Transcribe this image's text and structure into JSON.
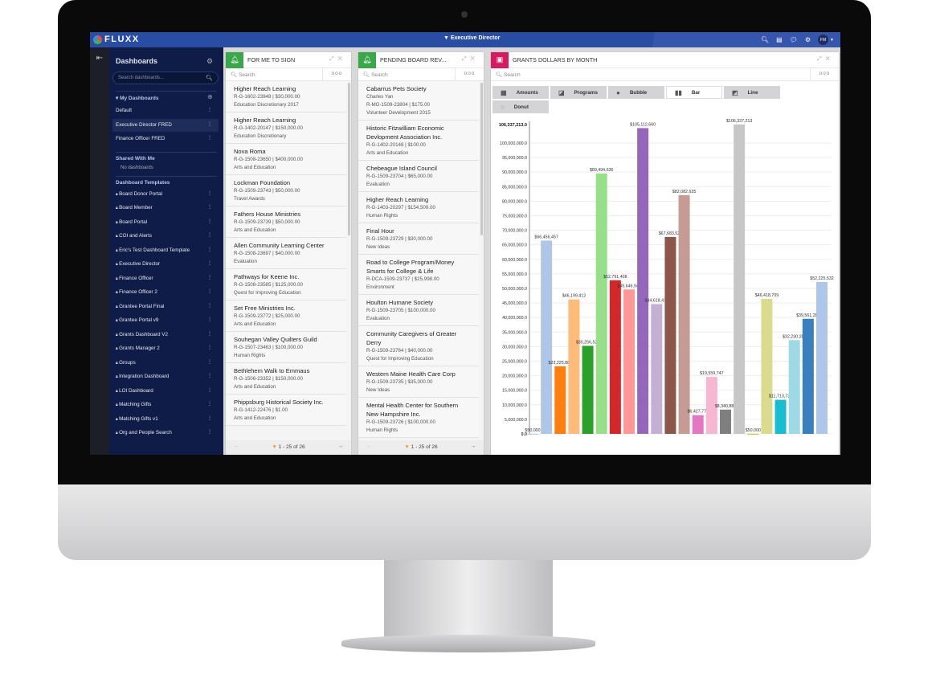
{
  "app": {
    "logo": "FLUXX",
    "title": "Executive Director",
    "user_initials": "FM"
  },
  "topbar_icons": [
    "search-icon",
    "card-icon",
    "chat-icon",
    "settings-icon"
  ],
  "sidebar": {
    "title": "Dashboards",
    "search_placeholder": "Search dashboards...",
    "my_dashboards": {
      "label": "My Dashboards",
      "items": [
        "Default",
        "Executive Director FRED",
        "Finance Officer FRED"
      ],
      "active": "Executive Director FRED"
    },
    "shared": {
      "label": "Shared With Me",
      "empty": "No dashboards"
    },
    "templates": {
      "label": "Dashboard Templates",
      "items": [
        "Board Donor Portal",
        "Board Member",
        "Board Portal",
        "COI and Alerts",
        "Eric's Test Dashboard Template",
        "Executive Director",
        "Finance Officer",
        "Finance Officer 2",
        "Grantee Portal Final",
        "Grantee Portal v9",
        "Grants Dashboard V2",
        "Grants Manager 2",
        "Groups",
        "Integration Dashboard",
        "LOI Dashboard",
        "Matching Gifts",
        "Matching Gifts v1",
        "Org and People Search"
      ]
    }
  },
  "panels": [
    {
      "title": "FOR ME TO SIGN",
      "color": "#3aa849",
      "search_placeholder": "Search",
      "pagination": "1 - 25 of 26",
      "items": [
        {
          "name": "Higher Reach Learning",
          "lines": [
            "R-G-1602-23948 | $30,000.00",
            "Education Discretionary 2017"
          ]
        },
        {
          "name": "Higher Reach Learning",
          "lines": [
            "R-G-1402-20147 | $150,000.00",
            "Education Discretionary"
          ]
        },
        {
          "name": "Nova Roma",
          "lines": [
            "R-G-1508-23650 | $400,000.00",
            "Arts and Education"
          ]
        },
        {
          "name": "Lockman Foundation",
          "lines": [
            "R-G-1509-23743 | $50,000.00",
            "Travel Awards"
          ]
        },
        {
          "name": "Fathers House Ministries",
          "lines": [
            "R-G-1509-23739 | $50,000.00",
            "Arts and Education"
          ]
        },
        {
          "name": "Allen Community Learning Center",
          "lines": [
            "R-G-1508-23697 | $40,000.00",
            "Evaluation"
          ]
        },
        {
          "name": "Pathways for Keene Inc.",
          "lines": [
            "R-G-1508-23585 | $125,000.00",
            "Quest for Improving Education"
          ]
        },
        {
          "name": "Set Free Ministries Inc.",
          "lines": [
            "R-G-1509-23772 | $25,000.00",
            "Arts and Education"
          ]
        },
        {
          "name": "Souhegan Valley Quilters Guild",
          "lines": [
            "R-G-1507-23463 | $100,000.00",
            "Human Rights"
          ]
        },
        {
          "name": "Bethlehem Walk to Emmaus",
          "lines": [
            "R-G-1506-23352 | $150,000.00",
            "Arts and Education"
          ]
        },
        {
          "name": "Phippsburg Historical Society Inc.",
          "lines": [
            "R-G-1412-22476 | $1.00",
            "Arts and Education"
          ]
        }
      ]
    },
    {
      "title": "PENDING BOARD REV...",
      "color": "#3aa849",
      "search_placeholder": "Search",
      "pagination": "1 - 25 of 26",
      "items": [
        {
          "name": "Cabarrus Pets Society",
          "lines": [
            "Charles Yan",
            "R-MG-1509-23804 | $175.00",
            "Volunteer Development 2015"
          ]
        },
        {
          "name": "Historic Fitzwilliam Economic Devlopment Association Inc.",
          "lines": [
            "R-G-1402-20148 | $100.00",
            "Arts and Education"
          ]
        },
        {
          "name": "Chebeague Island Council",
          "lines": [
            "R-G-1509-23704 | $65,000.00",
            "Evaluation"
          ]
        },
        {
          "name": "Higher Reach Learning",
          "lines": [
            "R-G-1403-20297 | $154,509.00",
            "Human Rights"
          ]
        },
        {
          "name": "Final Hour",
          "lines": [
            "R-G-1509-23729 | $30,000.00",
            "New Ideas"
          ]
        },
        {
          "name": "Road to College Program/Money Smarts for College & Life",
          "lines": [
            "R-DCA-1509-23737 | $25,998.00",
            "Environment"
          ]
        },
        {
          "name": "Houlton Humane Society",
          "lines": [
            "R-G-1509-23705 | $100,000.00",
            "Evaluation"
          ]
        },
        {
          "name": "Community Caregivers of Greater Derry",
          "lines": [
            "R-G-1509-23764 | $40,000.00",
            "Quest for Improving Education"
          ]
        },
        {
          "name": "Western Maine Health Care Corp",
          "lines": [
            "R-G-1509-23735 | $35,000.00",
            "New Ideas"
          ]
        },
        {
          "name": "Mental Health Center for Southern New Hampshire Inc.",
          "lines": [
            "R-G-1509-23726 | $100,000.00",
            "Human Rights"
          ]
        }
      ]
    }
  ],
  "chart_panel": {
    "title": "GRANTS DOLLARS BY MONTH",
    "color": "#d81b60",
    "search_placeholder": "Search",
    "tabs": [
      {
        "label": "Amounts",
        "icon": "table-icon"
      },
      {
        "label": "Programs",
        "icon": "programs-icon"
      },
      {
        "label": "Bubble",
        "icon": "bubble-icon"
      },
      {
        "label": "Bar",
        "icon": "bar-chart-icon",
        "selected": true
      },
      {
        "label": "Line",
        "icon": "line-chart-icon"
      },
      {
        "label": "Donut",
        "icon": "donut-icon"
      }
    ]
  },
  "chart_data": {
    "type": "bar",
    "title": "",
    "xlabel": "",
    "ylabel": "",
    "ylim": [
      0,
      106337213
    ],
    "grid": true,
    "yticks": [
      "0.0",
      "5,000,000.0",
      "10,000,000.0",
      "15,000,000.0",
      "20,000,000.0",
      "25,000,000.0",
      "30,000,000.0",
      "35,000,000.0",
      "40,000,000.0",
      "45,000,000.0",
      "50,000,000.0",
      "55,000,000.0",
      "60,000,000.0",
      "65,000,000.0",
      "70,000,000.0",
      "75,000,000.0",
      "80,000,000.0",
      "85,000,000.0",
      "90,000,000.0",
      "95,000,000.0",
      "100,000,000.0"
    ],
    "ymax_label": "106,337,213.0",
    "values": [
      50000,
      66456457,
      23225882,
      46199412,
      30256538,
      89494636,
      52791408,
      49646949,
      105112660,
      44618414,
      67683524,
      82082635,
      6427775,
      19559747,
      8340887,
      106337213,
      50000,
      46418709,
      11713737,
      32230288,
      39561282,
      52225532
    ],
    "labels": [
      "$50,000",
      "$66,456,457",
      "$23,225,882",
      "$46,199,412",
      "$30,256,538",
      "$89,494,636",
      "$52,791,408",
      "$49,646,949",
      "$105,112,660",
      "$44,618,414",
      "$67,683,524",
      "$82,082,635",
      "$6,427,775",
      "$19,559,747",
      "$8,340,887",
      "$106,337,213",
      "$50,000",
      "$46,418,709",
      "$11,713,737",
      "$32,230,288",
      "$39,561,282",
      "$52,225,532"
    ],
    "colors": [
      "#aec7e8",
      "#aec7e8",
      "#ff7f0e",
      "#ffbb78",
      "#2ca02c",
      "#98df8a",
      "#d62728",
      "#ff9896",
      "#9467bd",
      "#c5b0d5",
      "#8c564b",
      "#c49c94",
      "#e377c2",
      "#f7b6d2",
      "#7f7f7f",
      "#c7c7c7",
      "#bcbd22",
      "#dbdb8d",
      "#17becf",
      "#9edae5",
      "#3a7fc0",
      "#aec7e8"
    ]
  }
}
